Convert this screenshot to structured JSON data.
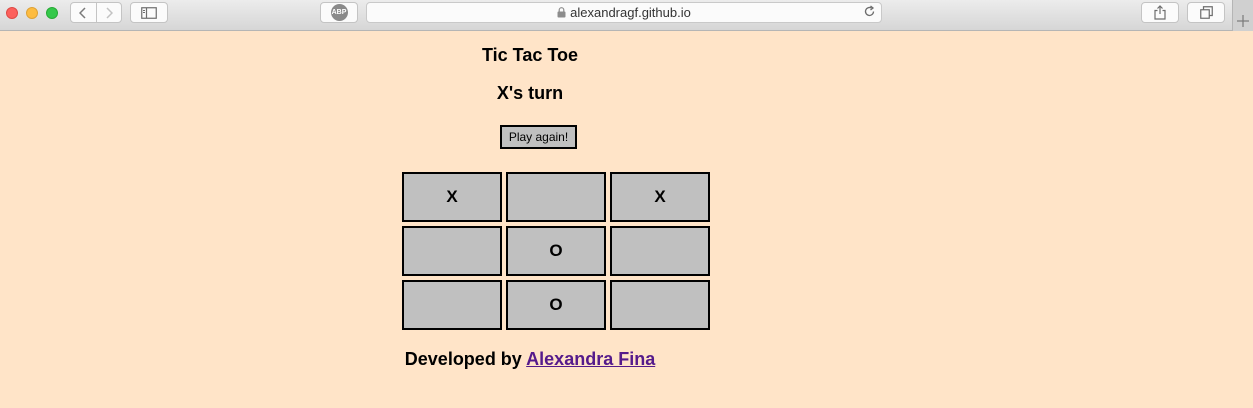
{
  "browser": {
    "url": "alexandragf.github.io",
    "adblock_label": "ABP",
    "icons": [
      "close-light",
      "minimize-light",
      "zoom-light",
      "back-icon",
      "forward-icon",
      "sidebar-icon",
      "lock-icon",
      "reload-icon",
      "share-icon",
      "tabs-icon",
      "new-tab-icon"
    ]
  },
  "game": {
    "title": "Tic Tac Toe",
    "status": "X's turn",
    "play_again_label": "Play again!",
    "board": [
      "X",
      "",
      "X",
      "",
      "O",
      "",
      "",
      "O",
      ""
    ]
  },
  "footer": {
    "prefix": "Developed by",
    "author_link": "Alexandra Fina"
  },
  "colors": {
    "page_background": "#ffe4c8",
    "cell_background": "#c0c0c0",
    "link": "#551a8b"
  }
}
